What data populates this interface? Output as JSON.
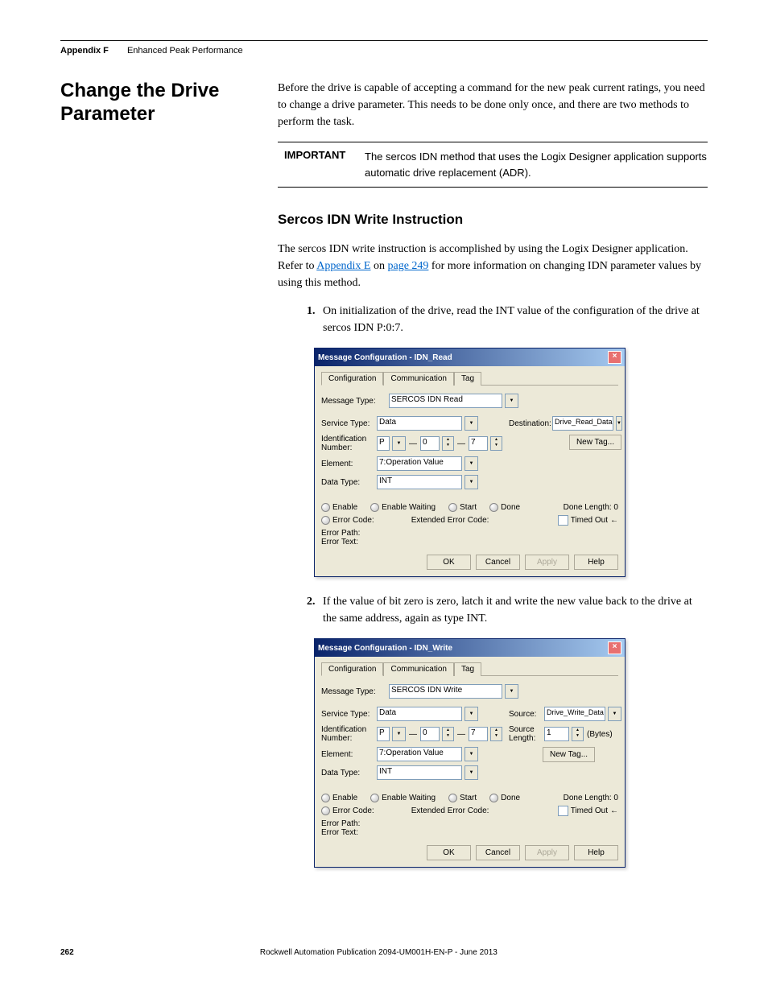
{
  "header": {
    "appendix": "Appendix F",
    "title": "Enhanced Peak Performance"
  },
  "section": {
    "title": "Change the Drive Parameter",
    "intro": "Before the drive is capable of accepting a command for the new peak current ratings, you need to change a drive parameter. This needs to be done only once, and there are two methods to perform the task."
  },
  "important": {
    "label": "IMPORTANT",
    "text": "The sercos IDN method that uses the Logix Designer application supports automatic drive replacement (ADR)."
  },
  "sub": {
    "title": "Sercos IDN Write Instruction",
    "p1a": "The sercos IDN write instruction is accomplished by using the Logix Designer application. Refer to ",
    "link1": "Appendix E",
    "p1b": " on ",
    "link2": "page 249",
    "p1c": " for more information on changing IDN parameter values by using this method."
  },
  "step1": "On initialization of the drive, read the INT value of the configuration of the drive at sercos IDN P:0:7.",
  "step2": "If the value of bit zero is zero, latch it and write the new value back to the drive at the same address, again as type INT.",
  "dialog1": {
    "title": "Message Configuration - IDN_Read",
    "tabs": [
      "Configuration",
      "Communication",
      "Tag"
    ],
    "msg_type_lbl": "Message Type:",
    "msg_type_val": "SERCOS IDN Read",
    "svc_lbl": "Service Type:",
    "svc_val": "Data",
    "idn_lbl": "Identification Number:",
    "idn_p": "P",
    "idn_0": "0",
    "idn_7": "7",
    "elem_lbl": "Element:",
    "elem_val": "7:Operation Value",
    "dt_lbl": "Data Type:",
    "dt_val": "INT",
    "dest_lbl": "Destination:",
    "dest_val": "Drive_Read_Data",
    "new_tag": "New Tag...",
    "enable": "Enable",
    "enable_wait": "Enable Waiting",
    "start": "Start",
    "done": "Done",
    "done_len": "Done Length: 0",
    "err_code": "Error Code:",
    "ext_err": "Extended Error Code:",
    "timed": "Timed Out",
    "err_path": "Error Path:",
    "err_text": "Error Text:",
    "ok": "OK",
    "cancel": "Cancel",
    "apply": "Apply",
    "help": "Help"
  },
  "dialog2": {
    "title": "Message Configuration - IDN_Write",
    "msg_type_val": "SERCOS IDN Write",
    "src_lbl": "Source:",
    "src_val": "Drive_Write_Data",
    "src_len_lbl": "Source Length:",
    "src_len_val": "1",
    "bytes": "(Bytes)"
  },
  "footer": {
    "page": "262",
    "pub": "Rockwell Automation Publication 2094-UM001H-EN-P - June 2013"
  }
}
